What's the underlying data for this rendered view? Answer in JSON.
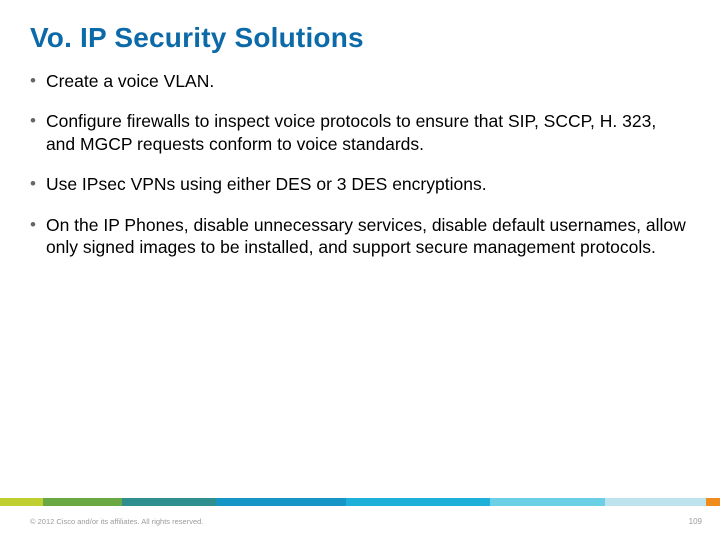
{
  "title": "Vo. IP Security Solutions",
  "bullets": {
    "b0": "Create a voice VLAN.",
    "b1": "Configure firewalls to inspect voice protocols to ensure that SIP, SCCP, H. 323, and MGCP requests conform to voice standards.",
    "b2": "Use IPsec VPNs using either DES or 3 DES encryptions.",
    "b3": "On the IP Phones, disable unnecessary services, disable default usernames, allow only signed images to be installed, and support secure management protocols."
  },
  "footer": "© 2012 Cisco and/or its affiliates. All rights reserved.",
  "page_number": "109"
}
